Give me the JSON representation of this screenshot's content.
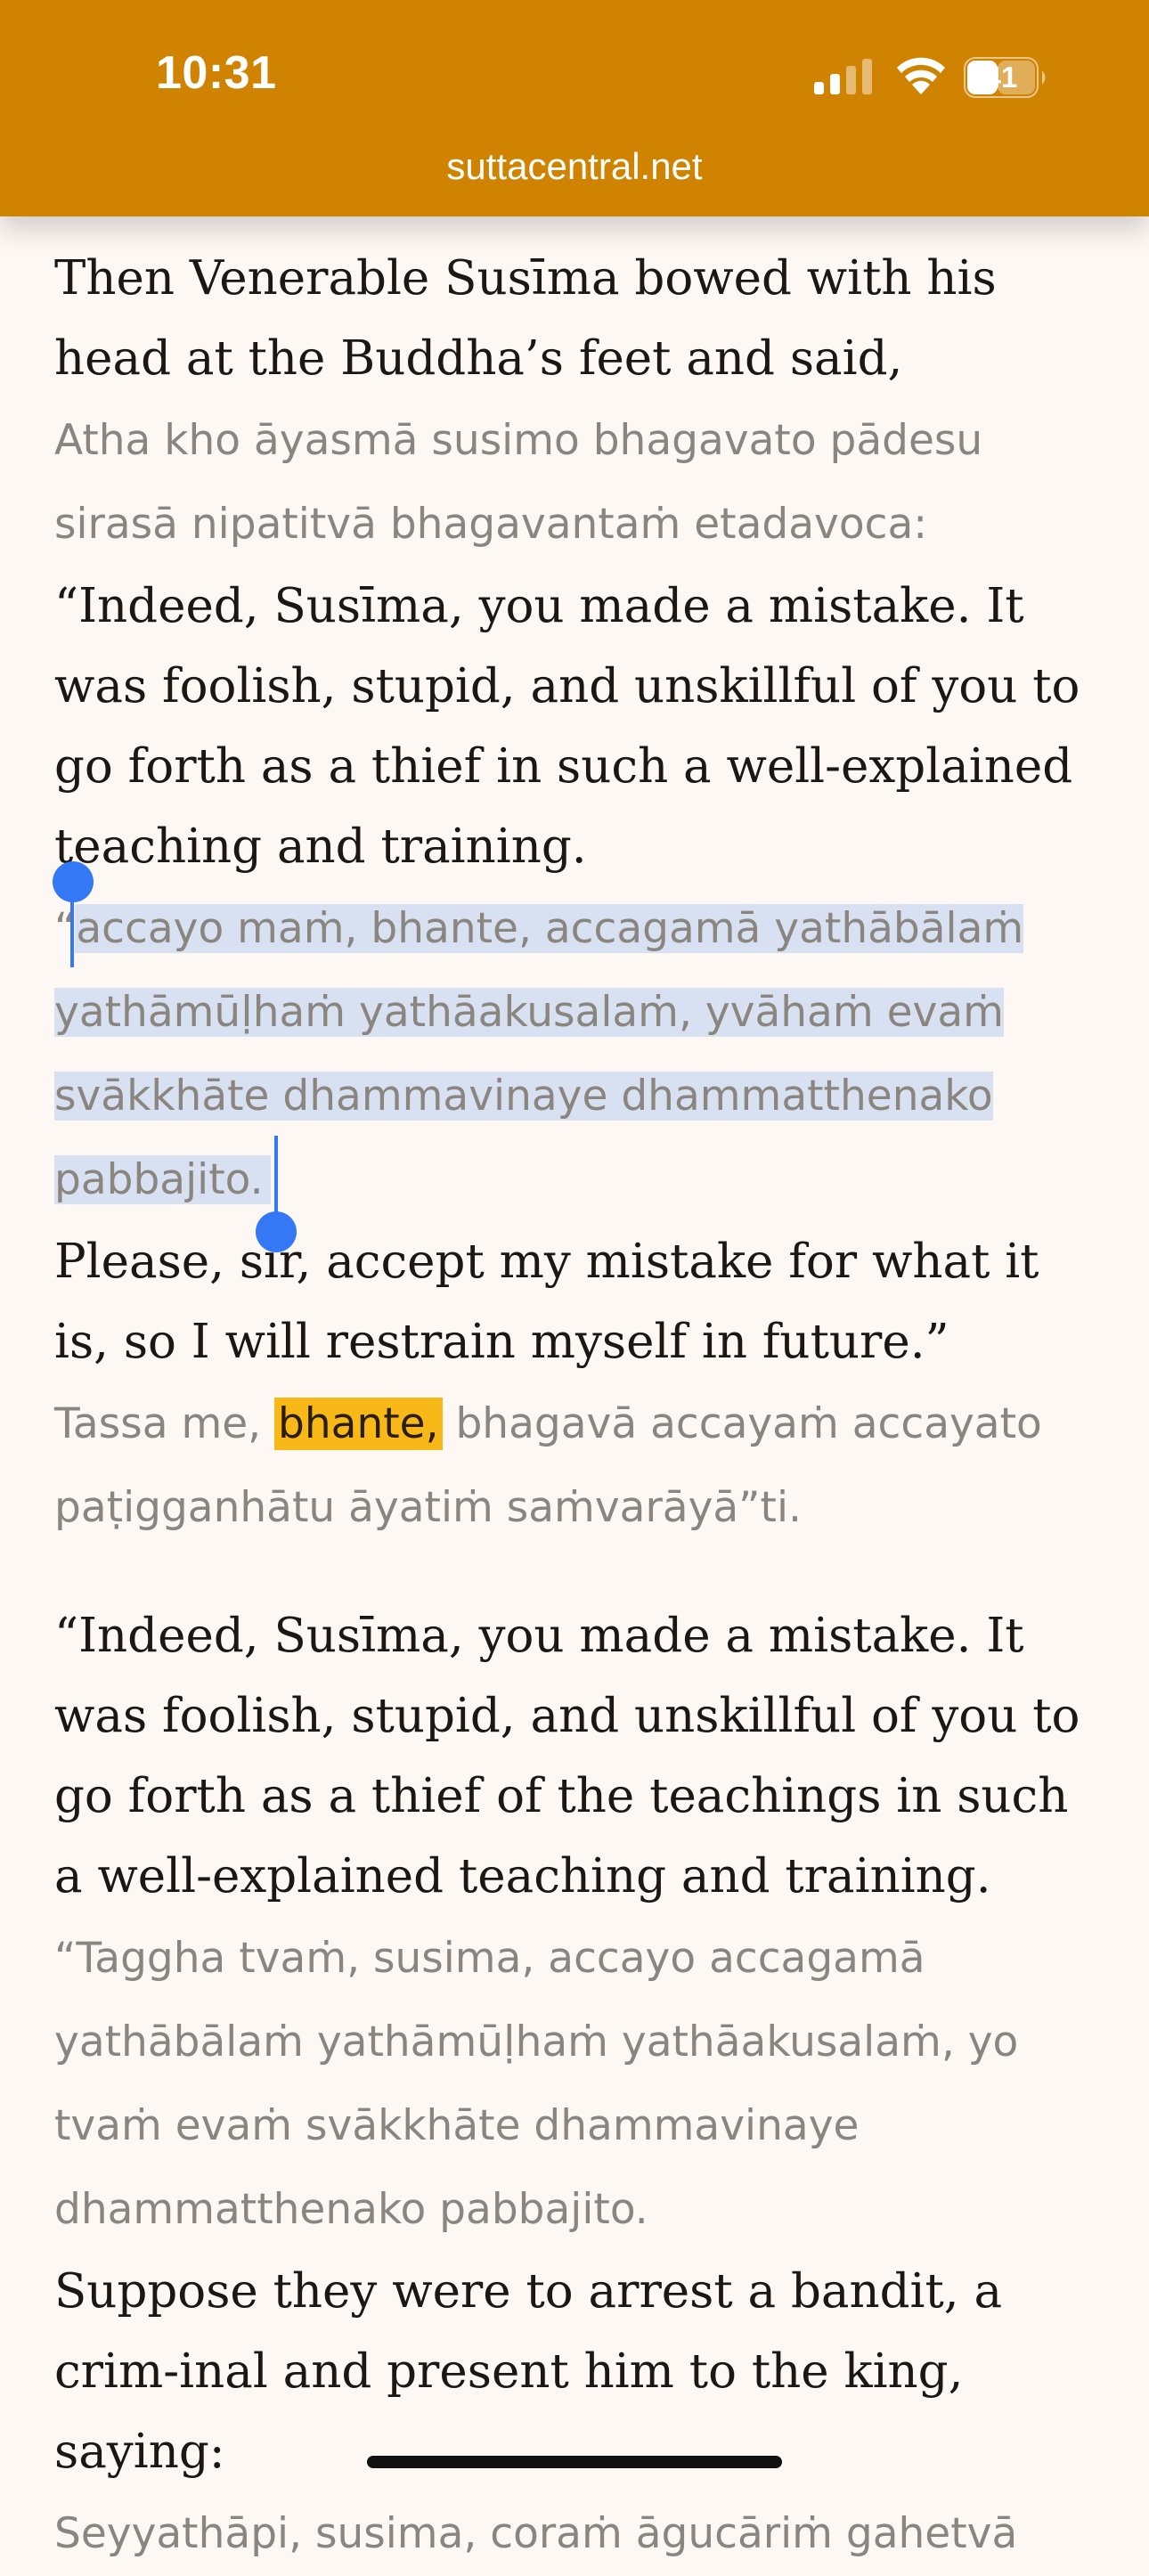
{
  "status_bar": {
    "time": "10:31",
    "battery": "41",
    "url": "suttacentral.net",
    "bar_color": "#cf8300"
  },
  "content": {
    "p1_en": "Then Venerable Susīma bowed with his head at the Buddha’s feet and said,",
    "p1_pali": "Atha kho āyasmā susimo bhagavato pādesu sirasā nipatitvā bhagavantaṁ etadavoca:",
    "p2_en": "“Indeed, Susīma, you made a mistake. It was foolish, stupid, and unskillful of you to go forth as a thief in such a well-explained teaching and training.",
    "p2_pali_open_quote": "“",
    "p2_pali_selected": "accayo maṁ, bhante, accagamā yathābālaṁ yathāmūḷhaṁ yathāakusalaṁ, yvāhaṁ evaṁ svākkhāte dhammavinaye dhammatthenako pabbajito.",
    "p3_en": "Please, sir, accept my mistake for what it is, so I will restrain myself in future.”",
    "p3_pali_before": "Tassa me, ",
    "p3_pali_highlight": "bhante,",
    "p3_pali_after": " bhagavā accayaṁ accayato paṭigganhātu āyatiṁ saṁvarāyā”ti.",
    "p4_en": "“Indeed, Susīma, you made a mistake. It was foolish, stupid, and unskillful of you to go forth as a thief of the teachings in such a well-explained teaching and training.",
    "p4_pali": "“Taggha tvaṁ, susima, accayo accagamā yathābālaṁ yathāmūḷhaṁ yathāakusalaṁ, yo tvaṁ evaṁ svākkhāte dhammavinaye dhammatthenako pabbajito.",
    "p5_en": "Suppose they were to arrest a bandit, a crim-inal and present him to the king, saying:",
    "p5_pali": "Seyyathāpi, susima, coraṁ āgucāriṁ gahetvā"
  },
  "colors": {
    "selection": "#d8e1f2",
    "selection_handle": "#3478f6",
    "highlight": "#f7b818",
    "background": "#fdf8f3"
  }
}
